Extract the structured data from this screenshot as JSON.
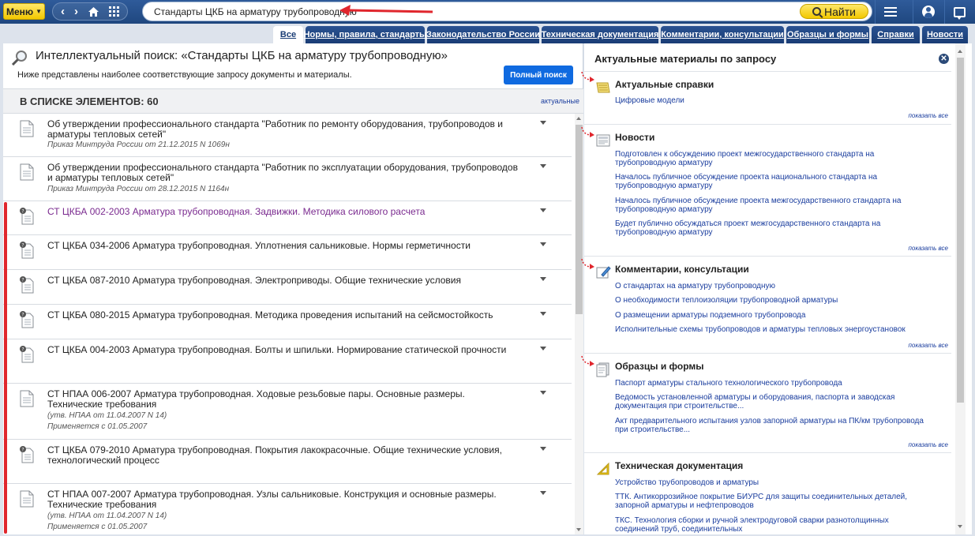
{
  "topbar": {
    "menu_label": "Меню",
    "search_value": "Стандарты ЦКБ на арматуру трубопроводную",
    "find_label": "Найти"
  },
  "tabs": [
    {
      "label": "Все"
    },
    {
      "label": "Нормы, правила, стандарты"
    },
    {
      "label": "Законодательство России"
    },
    {
      "label": "Техническая документация"
    },
    {
      "label": "Комментарии, консультации"
    },
    {
      "label": "Образцы и формы"
    },
    {
      "label": "Справки"
    },
    {
      "label": "Новости"
    }
  ],
  "left": {
    "title": "Интеллектуальный поиск: «Стандарты ЦКБ на арматуру трубопроводную»",
    "subtitle": "Ниже представлены наиболее соответствующие запросу документы и материалы.",
    "full_search_label": "Полный поиск",
    "list_count": "В СПИСКЕ ЭЛЕМЕНТОВ: 60",
    "actual_link": "актуальные",
    "items": [
      {
        "title": "Об утверждении профессионального стандарта \"Работник по ремонту оборудования, трубопроводов и арматуры тепловых сетей\"",
        "meta": [
          "Приказ Минтруда России от 21.12.2015 N 1069н"
        ],
        "icon": "document-icon"
      },
      {
        "title": "Об утверждении профессионального стандарта \"Работник по эксплуатации оборудования, трубопроводов и арматуры тепловых сетей\"",
        "meta": [
          "Приказ Минтруда России от 28.12.2015 N 1164н"
        ],
        "icon": "document-icon"
      },
      {
        "title": "СТ ЦКБА 002-2003 Арматура трубопроводная. Задвижки. Методика силового расчета",
        "meta": [],
        "icon": "unknown-status-document-icon"
      },
      {
        "title": "СТ ЦКБА 034-2006 Арматура трубопроводная. Уплотнения сальниковые. Нормы герметичности",
        "meta": [],
        "icon": "unknown-status-document-icon"
      },
      {
        "title": "СТ ЦКБА 087-2010 Арматура трубопроводная. Электроприводы. Общие технические условия",
        "meta": [],
        "icon": "unknown-status-document-icon"
      },
      {
        "title": "СТ ЦКБА 080-2015 Арматура трубопроводная. Методика проведения испытаний на сейсмостойкость",
        "meta": [],
        "icon": "unknown-status-document-icon"
      },
      {
        "title": "СТ ЦКБА 004-2003 Арматура трубопроводная. Болты и шпильки. Нормирование статической прочности",
        "meta": [],
        "icon": "unknown-status-document-icon"
      },
      {
        "title": "СТ НПАА 006-2007 Арматура трубопроводная. Ходовые резьбовые пары. Основные размеры. Технические требования",
        "meta": [
          "(утв. НПАА от 11.04.2007 N 14)",
          "Применяется с 01.05.2007"
        ],
        "icon": "document-icon"
      },
      {
        "title": "СТ ЦКБА 079-2010 Арматура трубопроводная. Покрытия лакокрасочные. Общие технические условия, технологический процесс",
        "meta": [],
        "icon": "unknown-status-document-icon"
      },
      {
        "title": "СТ НПАА 007-2007 Арматура трубопроводная. Узлы сальниковые. Конструкция и основные размеры. Технические требования",
        "meta": [
          "(утв. НПАА от 11.04.2007 N 14)",
          "Применяется с 01.05.2007"
        ],
        "icon": "document-icon"
      }
    ]
  },
  "right": {
    "title": "Актуальные материалы по запросу",
    "show_all": "показать все",
    "sections": [
      {
        "title": "Актуальные справки",
        "icon": "reference-icon",
        "links": [
          "Цифровые модели"
        ]
      },
      {
        "title": "Новости",
        "icon": "news-icon",
        "links": [
          "Подготовлен к обсуждению проект межгосударственного стандарта на трубопроводную арматуру",
          "Началось публичное обсуждение проекта национального стандарта на трубопроводную арматуру",
          "Началось публичное обсуждение проекта межгосударственного стандарта на трубопроводную арматуру",
          "Будет публично обсуждаться проект межгосударственного стандарта на трубопроводную арматуру"
        ]
      },
      {
        "title": "Комментарии, консультации",
        "icon": "comment-icon",
        "links": [
          "О стандартах на арматуру трубопроводную",
          "О необходимости теплоизоляции трубопроводной арматуры",
          "О размещении арматуры подземного трубопровода",
          "Исполнительные схемы трубопроводов и арматуры тепловых энергоустановок"
        ]
      },
      {
        "title": "Образцы и формы",
        "icon": "forms-icon",
        "links": [
          "Паспорт арматуры стального технологического трубопровода",
          "Ведомость установленной арматуры и оборудования, паспорта и заводская документация при строительстве...",
          "Акт предварительного испытания узлов запорной арматуры на ПК/км трубопровода при строительстве..."
        ]
      },
      {
        "title": "Техническая документация",
        "icon": "tech-doc-icon",
        "links": [
          "Устройство трубопроводов и арматуры",
          "ТТК. Антикоррозийное покрытие БИУРС для защиты соединительных деталей, запорной арматуры и нефтепроводов",
          "ТКС. Технология сборки и ручной электродуговой сварки разнотолщинных соединений труб, соединительных"
        ]
      }
    ]
  },
  "colors": {
    "accent_blue": "#1f477f",
    "link_blue": "#1a3d9e",
    "yellow": "#f2c800",
    "annotation_red": "#e0262d",
    "visited": "#7a2a8f"
  }
}
